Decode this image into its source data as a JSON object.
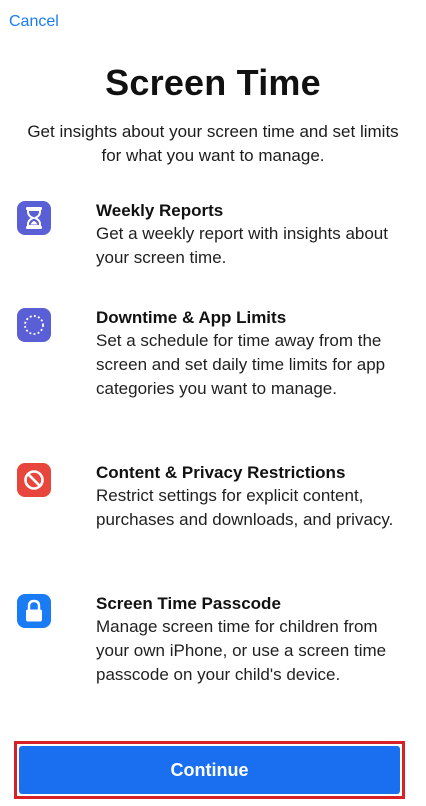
{
  "header": {
    "cancel_label": "Cancel"
  },
  "title": "Screen Time",
  "subtitle": "Get insights about your screen time and set limits for what you want to manage.",
  "features": [
    {
      "icon": "hourglass-icon",
      "icon_color": "#5b5fd6",
      "title": "Weekly Reports",
      "description": "Get a weekly report with insights about your screen time."
    },
    {
      "icon": "downtime-moon-icon",
      "icon_color": "#5b5fd6",
      "title": "Downtime & App Limits",
      "description": "Set a schedule for time away from the screen and set daily time limits for app categories you want to manage."
    },
    {
      "icon": "restriction-icon",
      "icon_color": "#e8453c",
      "title": "Content & Privacy Restrictions",
      "description": "Restrict settings for explicit content, purchases and downloads, and privacy."
    },
    {
      "icon": "lock-icon",
      "icon_color": "#1a7cf5",
      "title": "Screen Time Passcode",
      "description": "Manage screen time for children from your own iPhone, or use a screen time passcode on your child's device."
    }
  ],
  "continue_label": "Continue",
  "colors": {
    "accent": "#1a7cf5",
    "button": "#1a6ff0",
    "highlight_border": "#d72028"
  }
}
